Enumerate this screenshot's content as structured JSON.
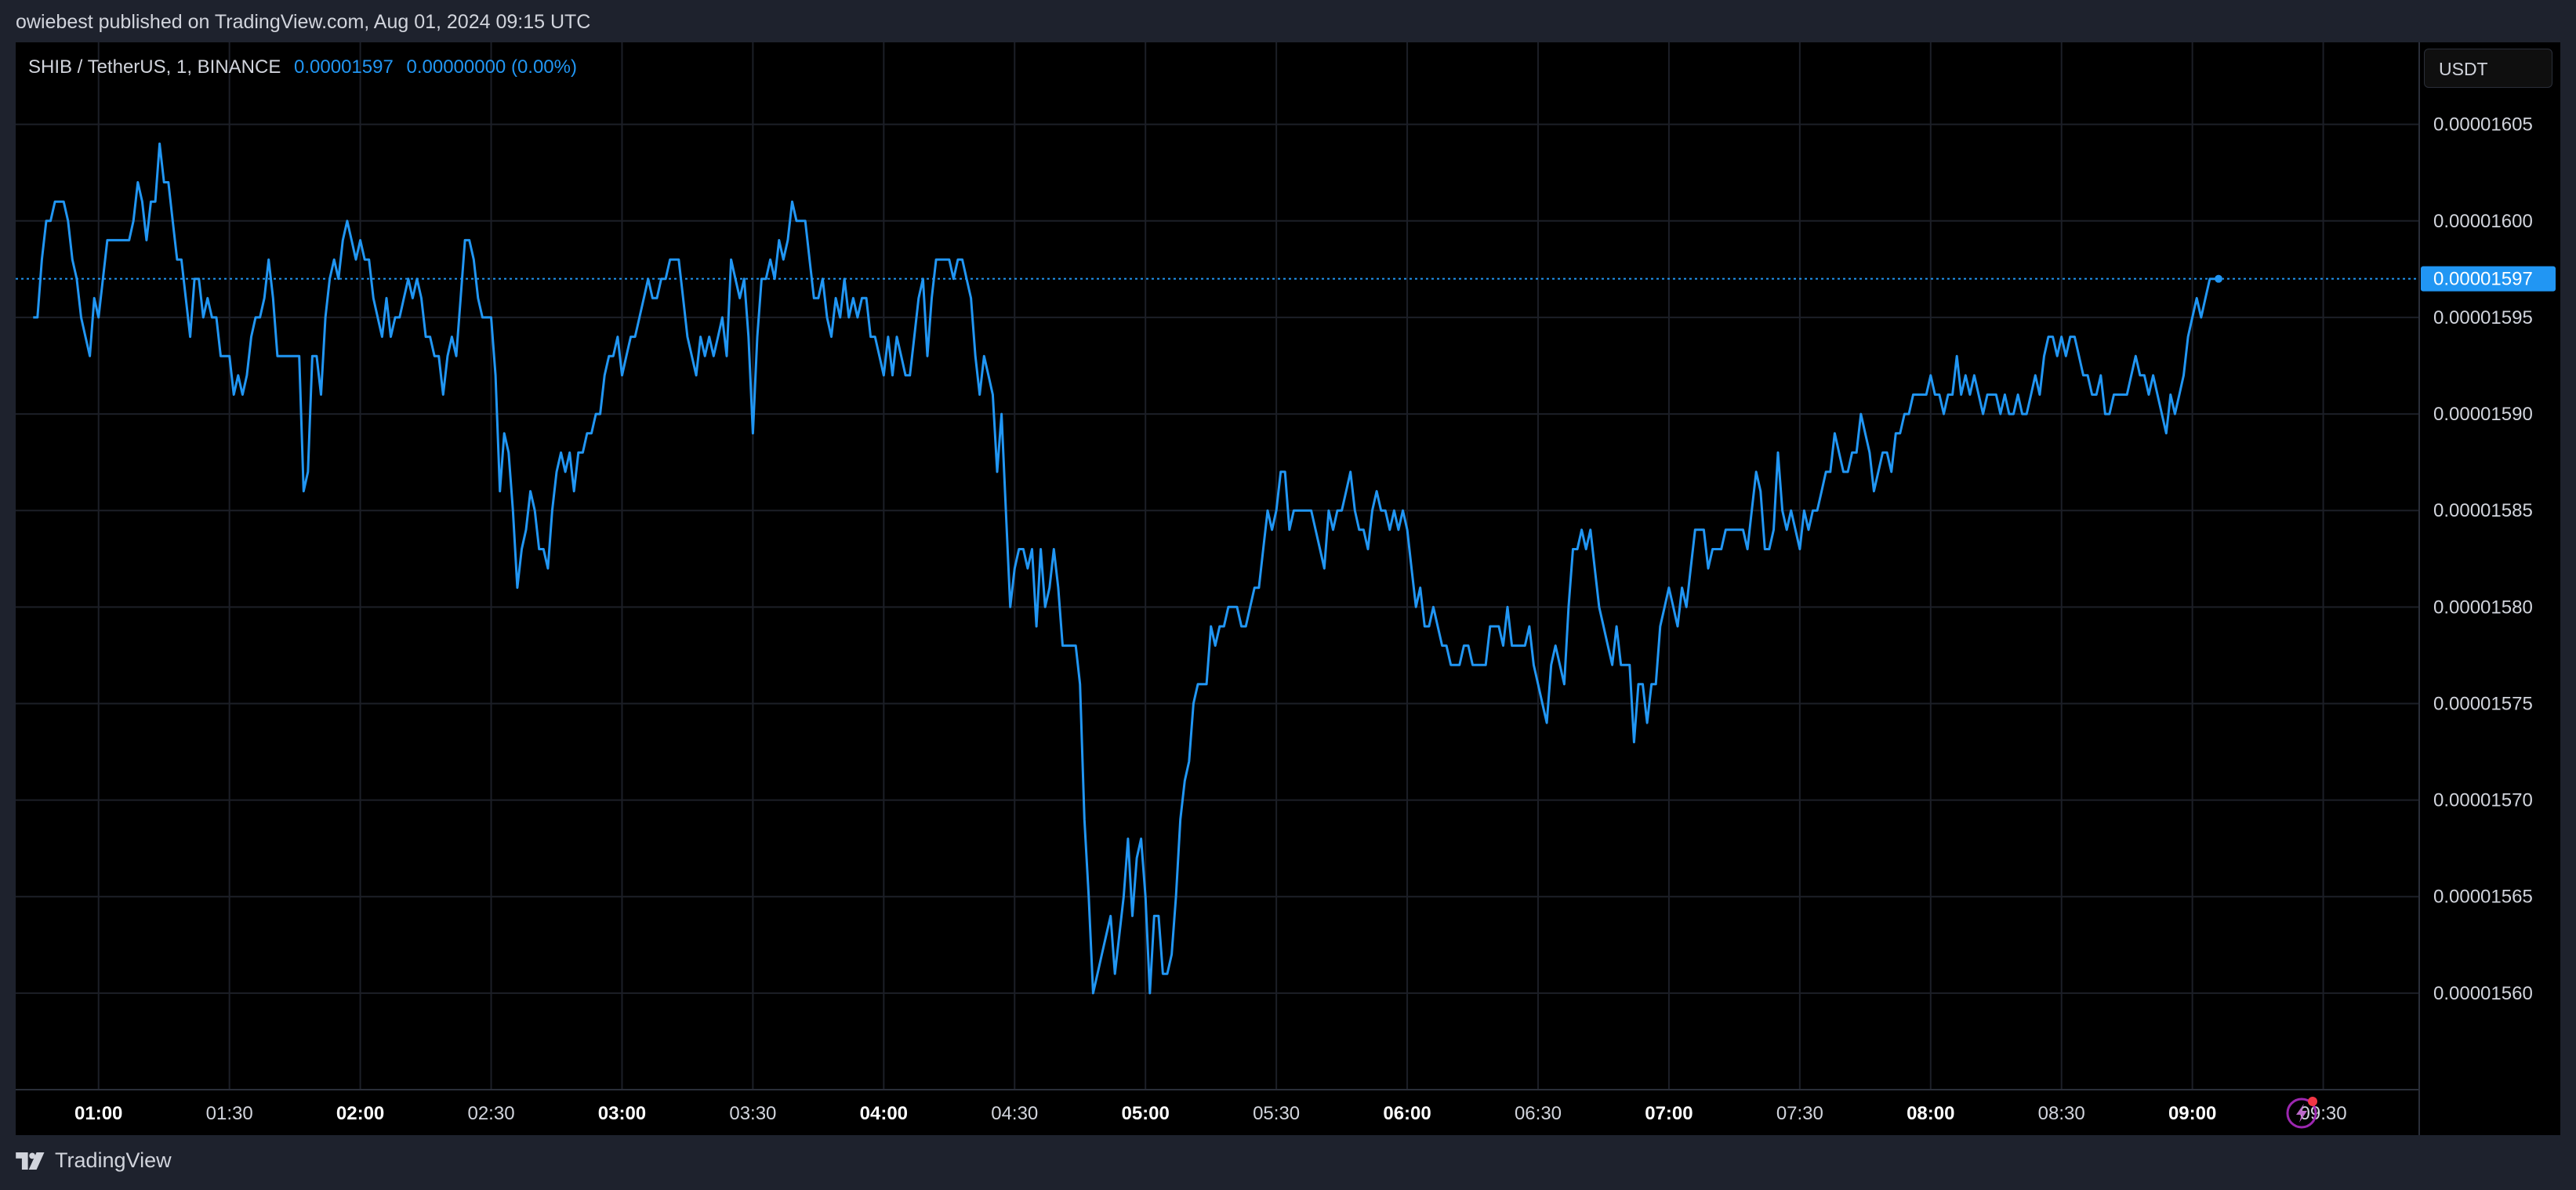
{
  "header": {
    "published_text": "owiebest published on TradingView.com, Aug 01, 2024 09:15 UTC"
  },
  "legend": {
    "symbol": "SHIB / TetherUS, 1, BINANCE",
    "price": "0.00001597",
    "change": "0.00000000 (0.00%)"
  },
  "currency_button": {
    "label": "USDT"
  },
  "footer": {
    "brand": "TradingView"
  },
  "colors": {
    "line": "#2196f3",
    "background": "#000000",
    "frame": "#1e222d",
    "grid": "#1c1f27",
    "text": "#d1d4dc"
  },
  "icons": {
    "brand_logo": "tradingview-logo-icon",
    "alert": "lightning-bolt-icon"
  },
  "chart_data": {
    "type": "line",
    "title": "SHIB / TetherUS, 1, BINANCE",
    "xlabel": "",
    "ylabel": "",
    "x_start": "00:45",
    "x_step_minutes": 1,
    "xlim": [
      "00:41",
      "09:52"
    ],
    "ylim": [
      1.555e-05,
      1.60925e-05
    ],
    "x_ticks": [
      {
        "label": "01:00",
        "minutes": 60,
        "bold": true
      },
      {
        "label": "01:30",
        "minutes": 90,
        "bold": false
      },
      {
        "label": "02:00",
        "minutes": 120,
        "bold": true
      },
      {
        "label": "02:30",
        "minutes": 150,
        "bold": false
      },
      {
        "label": "03:00",
        "minutes": 180,
        "bold": true
      },
      {
        "label": "03:30",
        "minutes": 210,
        "bold": false
      },
      {
        "label": "04:00",
        "minutes": 240,
        "bold": true
      },
      {
        "label": "04:30",
        "minutes": 270,
        "bold": false
      },
      {
        "label": "05:00",
        "minutes": 300,
        "bold": true
      },
      {
        "label": "05:30",
        "minutes": 330,
        "bold": false
      },
      {
        "label": "06:00",
        "minutes": 360,
        "bold": true
      },
      {
        "label": "06:30",
        "minutes": 390,
        "bold": false
      },
      {
        "label": "07:00",
        "minutes": 420,
        "bold": true
      },
      {
        "label": "07:30",
        "minutes": 450,
        "bold": false
      },
      {
        "label": "08:00",
        "minutes": 480,
        "bold": true
      },
      {
        "label": "08:30",
        "minutes": 510,
        "bold": false
      },
      {
        "label": "09:00",
        "minutes": 540,
        "bold": true
      },
      {
        "label": "09:30",
        "minutes": 570,
        "bold": false
      }
    ],
    "y_ticks": [
      {
        "label": "0.00001605",
        "value": 1.605e-05
      },
      {
        "label": "0.00001600",
        "value": 1.6e-05
      },
      {
        "label": "0.00001595",
        "value": 1.595e-05
      },
      {
        "label": "0.00001590",
        "value": 1.59e-05
      },
      {
        "label": "0.00001585",
        "value": 1.585e-05
      },
      {
        "label": "0.00001580",
        "value": 1.58e-05
      },
      {
        "label": "0.00001575",
        "value": 1.575e-05
      },
      {
        "label": "0.00001570",
        "value": 1.57e-05
      },
      {
        "label": "0.00001565",
        "value": 1.565e-05
      },
      {
        "label": "0.00001560",
        "value": 1.56e-05
      }
    ],
    "last_price": {
      "label": "0.00001597",
      "value": 1.597e-05
    },
    "series": [
      {
        "values": [
          1.595e-05,
          1.595e-05,
          1.598e-05,
          1.6e-05,
          1.6e-05,
          1.601e-05,
          1.601e-05,
          1.601e-05,
          1.6e-05,
          1.598e-05,
          1.597e-05,
          1.595e-05,
          1.594e-05,
          1.593e-05,
          1.596e-05,
          1.595e-05,
          1.597e-05,
          1.599e-05,
          1.599e-05,
          1.599e-05,
          1.599e-05,
          1.599e-05,
          1.599e-05,
          1.6e-05,
          1.602e-05,
          1.601e-05,
          1.599e-05,
          1.601e-05,
          1.601e-05,
          1.604e-05,
          1.602e-05,
          1.602e-05,
          1.6e-05,
          1.598e-05,
          1.598e-05,
          1.596e-05,
          1.594e-05,
          1.597e-05,
          1.597e-05,
          1.595e-05,
          1.596e-05,
          1.595e-05,
          1.595e-05,
          1.593e-05,
          1.593e-05,
          1.593e-05,
          1.591e-05,
          1.592e-05,
          1.591e-05,
          1.592e-05,
          1.594e-05,
          1.595e-05,
          1.595e-05,
          1.596e-05,
          1.598e-05,
          1.596e-05,
          1.593e-05,
          1.593e-05,
          1.593e-05,
          1.593e-05,
          1.593e-05,
          1.593e-05,
          1.586e-05,
          1.587e-05,
          1.593e-05,
          1.593e-05,
          1.591e-05,
          1.595e-05,
          1.597e-05,
          1.598e-05,
          1.597e-05,
          1.599e-05,
          1.6e-05,
          1.599e-05,
          1.598e-05,
          1.599e-05,
          1.598e-05,
          1.598e-05,
          1.596e-05,
          1.595e-05,
          1.594e-05,
          1.596e-05,
          1.594e-05,
          1.595e-05,
          1.595e-05,
          1.596e-05,
          1.597e-05,
          1.596e-05,
          1.597e-05,
          1.596e-05,
          1.594e-05,
          1.594e-05,
          1.593e-05,
          1.593e-05,
          1.591e-05,
          1.593e-05,
          1.594e-05,
          1.593e-05,
          1.596e-05,
          1.599e-05,
          1.599e-05,
          1.598e-05,
          1.596e-05,
          1.595e-05,
          1.595e-05,
          1.595e-05,
          1.592e-05,
          1.586e-05,
          1.589e-05,
          1.588e-05,
          1.585e-05,
          1.581e-05,
          1.583e-05,
          1.584e-05,
          1.586e-05,
          1.585e-05,
          1.583e-05,
          1.583e-05,
          1.582e-05,
          1.585e-05,
          1.587e-05,
          1.588e-05,
          1.587e-05,
          1.588e-05,
          1.586e-05,
          1.588e-05,
          1.588e-05,
          1.589e-05,
          1.589e-05,
          1.59e-05,
          1.59e-05,
          1.592e-05,
          1.593e-05,
          1.593e-05,
          1.594e-05,
          1.592e-05,
          1.593e-05,
          1.594e-05,
          1.594e-05,
          1.595e-05,
          1.596e-05,
          1.597e-05,
          1.596e-05,
          1.596e-05,
          1.597e-05,
          1.597e-05,
          1.598e-05,
          1.598e-05,
          1.598e-05,
          1.596e-05,
          1.594e-05,
          1.593e-05,
          1.592e-05,
          1.594e-05,
          1.593e-05,
          1.594e-05,
          1.593e-05,
          1.594e-05,
          1.595e-05,
          1.593e-05,
          1.598e-05,
          1.597e-05,
          1.596e-05,
          1.597e-05,
          1.594e-05,
          1.589e-05,
          1.594e-05,
          1.597e-05,
          1.597e-05,
          1.598e-05,
          1.597e-05,
          1.599e-05,
          1.598e-05,
          1.599e-05,
          1.601e-05,
          1.6e-05,
          1.6e-05,
          1.6e-05,
          1.598e-05,
          1.596e-05,
          1.596e-05,
          1.597e-05,
          1.595e-05,
          1.594e-05,
          1.596e-05,
          1.595e-05,
          1.597e-05,
          1.595e-05,
          1.596e-05,
          1.595e-05,
          1.596e-05,
          1.596e-05,
          1.594e-05,
          1.594e-05,
          1.593e-05,
          1.592e-05,
          1.594e-05,
          1.592e-05,
          1.594e-05,
          1.593e-05,
          1.592e-05,
          1.592e-05,
          1.594e-05,
          1.596e-05,
          1.597e-05,
          1.593e-05,
          1.596e-05,
          1.598e-05,
          1.598e-05,
          1.598e-05,
          1.598e-05,
          1.597e-05,
          1.598e-05,
          1.598e-05,
          1.597e-05,
          1.596e-05,
          1.593e-05,
          1.591e-05,
          1.593e-05,
          1.592e-05,
          1.591e-05,
          1.587e-05,
          1.59e-05,
          1.585e-05,
          1.58e-05,
          1.582e-05,
          1.583e-05,
          1.583e-05,
          1.582e-05,
          1.583e-05,
          1.579e-05,
          1.583e-05,
          1.58e-05,
          1.581e-05,
          1.583e-05,
          1.581e-05,
          1.578e-05,
          1.578e-05,
          1.578e-05,
          1.578e-05,
          1.576e-05,
          1.569e-05,
          1.565e-05,
          1.56e-05,
          1.561e-05,
          1.562e-05,
          1.563e-05,
          1.564e-05,
          1.561e-05,
          1.563e-05,
          1.565e-05,
          1.568e-05,
          1.564e-05,
          1.567e-05,
          1.568e-05,
          1.565e-05,
          1.56e-05,
          1.564e-05,
          1.564e-05,
          1.561e-05,
          1.561e-05,
          1.562e-05,
          1.565e-05,
          1.569e-05,
          1.571e-05,
          1.572e-05,
          1.575e-05,
          1.576e-05,
          1.576e-05,
          1.576e-05,
          1.579e-05,
          1.578e-05,
          1.579e-05,
          1.579e-05,
          1.58e-05,
          1.58e-05,
          1.58e-05,
          1.579e-05,
          1.579e-05,
          1.58e-05,
          1.581e-05,
          1.581e-05,
          1.583e-05,
          1.585e-05,
          1.584e-05,
          1.585e-05,
          1.587e-05,
          1.587e-05,
          1.584e-05,
          1.585e-05,
          1.585e-05,
          1.585e-05,
          1.585e-05,
          1.585e-05,
          1.584e-05,
          1.583e-05,
          1.582e-05,
          1.585e-05,
          1.584e-05,
          1.585e-05,
          1.585e-05,
          1.586e-05,
          1.587e-05,
          1.585e-05,
          1.584e-05,
          1.584e-05,
          1.583e-05,
          1.585e-05,
          1.586e-05,
          1.585e-05,
          1.585e-05,
          1.584e-05,
          1.585e-05,
          1.584e-05,
          1.585e-05,
          1.584e-05,
          1.582e-05,
          1.58e-05,
          1.581e-05,
          1.579e-05,
          1.579e-05,
          1.58e-05,
          1.579e-05,
          1.578e-05,
          1.578e-05,
          1.577e-05,
          1.577e-05,
          1.577e-05,
          1.578e-05,
          1.578e-05,
          1.577e-05,
          1.577e-05,
          1.577e-05,
          1.577e-05,
          1.579e-05,
          1.579e-05,
          1.579e-05,
          1.578e-05,
          1.58e-05,
          1.578e-05,
          1.578e-05,
          1.578e-05,
          1.578e-05,
          1.579e-05,
          1.577e-05,
          1.576e-05,
          1.575e-05,
          1.574e-05,
          1.577e-05,
          1.578e-05,
          1.577e-05,
          1.576e-05,
          1.58e-05,
          1.583e-05,
          1.583e-05,
          1.584e-05,
          1.583e-05,
          1.584e-05,
          1.582e-05,
          1.58e-05,
          1.579e-05,
          1.578e-05,
          1.577e-05,
          1.579e-05,
          1.577e-05,
          1.577e-05,
          1.577e-05,
          1.573e-05,
          1.576e-05,
          1.576e-05,
          1.574e-05,
          1.576e-05,
          1.576e-05,
          1.579e-05,
          1.58e-05,
          1.581e-05,
          1.58e-05,
          1.579e-05,
          1.581e-05,
          1.58e-05,
          1.582e-05,
          1.584e-05,
          1.584e-05,
          1.584e-05,
          1.582e-05,
          1.583e-05,
          1.583e-05,
          1.583e-05,
          1.584e-05,
          1.584e-05,
          1.584e-05,
          1.584e-05,
          1.584e-05,
          1.583e-05,
          1.585e-05,
          1.587e-05,
          1.586e-05,
          1.583e-05,
          1.583e-05,
          1.584e-05,
          1.588e-05,
          1.585e-05,
          1.584e-05,
          1.585e-05,
          1.584e-05,
          1.583e-05,
          1.585e-05,
          1.584e-05,
          1.585e-05,
          1.585e-05,
          1.586e-05,
          1.587e-05,
          1.587e-05,
          1.589e-05,
          1.588e-05,
          1.587e-05,
          1.587e-05,
          1.588e-05,
          1.588e-05,
          1.59e-05,
          1.589e-05,
          1.588e-05,
          1.586e-05,
          1.587e-05,
          1.588e-05,
          1.588e-05,
          1.587e-05,
          1.589e-05,
          1.589e-05,
          1.59e-05,
          1.59e-05,
          1.591e-05,
          1.591e-05,
          1.591e-05,
          1.591e-05,
          1.592e-05,
          1.591e-05,
          1.591e-05,
          1.59e-05,
          1.591e-05,
          1.591e-05,
          1.593e-05,
          1.591e-05,
          1.592e-05,
          1.591e-05,
          1.592e-05,
          1.591e-05,
          1.59e-05,
          1.591e-05,
          1.591e-05,
          1.591e-05,
          1.59e-05,
          1.591e-05,
          1.59e-05,
          1.59e-05,
          1.591e-05,
          1.59e-05,
          1.59e-05,
          1.591e-05,
          1.592e-05,
          1.591e-05,
          1.593e-05,
          1.594e-05,
          1.594e-05,
          1.593e-05,
          1.594e-05,
          1.593e-05,
          1.594e-05,
          1.594e-05,
          1.593e-05,
          1.592e-05,
          1.592e-05,
          1.591e-05,
          1.591e-05,
          1.592e-05,
          1.59e-05,
          1.59e-05,
          1.591e-05,
          1.591e-05,
          1.591e-05,
          1.591e-05,
          1.592e-05,
          1.593e-05,
          1.592e-05,
          1.592e-05,
          1.591e-05,
          1.592e-05,
          1.591e-05,
          1.59e-05,
          1.589e-05,
          1.591e-05,
          1.59e-05,
          1.591e-05,
          1.592e-05,
          1.594e-05,
          1.595e-05,
          1.596e-05,
          1.595e-05,
          1.596e-05,
          1.597e-05,
          1.597e-05,
          1.597e-05
        ]
      }
    ]
  }
}
